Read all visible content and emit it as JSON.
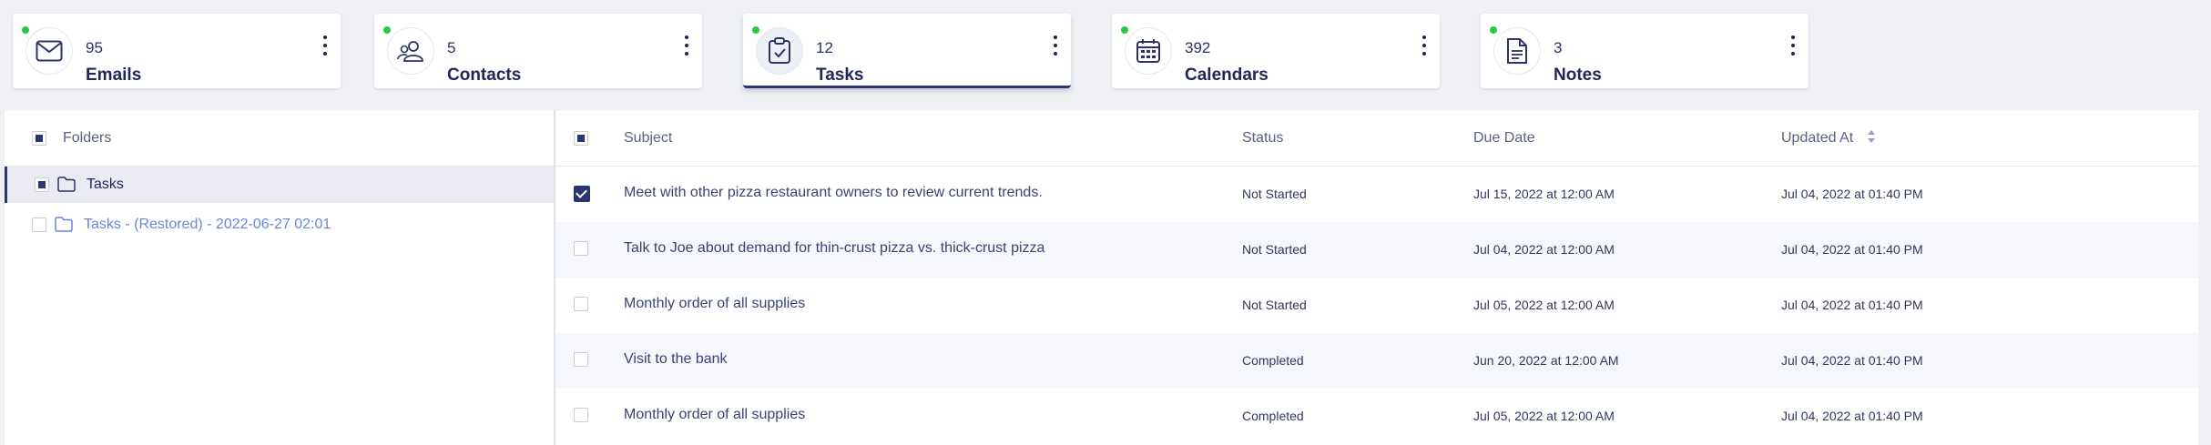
{
  "cards": [
    {
      "count": "95",
      "label": "Emails",
      "icon": "mail-icon",
      "active": false
    },
    {
      "count": "5",
      "label": "Contacts",
      "icon": "contacts-icon",
      "active": false
    },
    {
      "count": "12",
      "label": "Tasks",
      "icon": "clipboard-check-icon",
      "active": true
    },
    {
      "count": "392",
      "label": "Calendars",
      "icon": "calendar-icon",
      "active": false
    },
    {
      "count": "3",
      "label": "Notes",
      "icon": "document-icon",
      "active": false
    }
  ],
  "colors": {
    "accent": "#2b3576",
    "status_dot": "#28c840",
    "restored_link": "#6b86d6",
    "background": "#eff1f4"
  },
  "folders": {
    "header": "Folders",
    "items": [
      {
        "label": "Tasks",
        "selected": true
      },
      {
        "label": "Tasks - (Restored) - 2022-06-27 02:01",
        "selected": false
      }
    ]
  },
  "table": {
    "columns": {
      "subject": "Subject",
      "status": "Status",
      "due_date": "Due Date",
      "updated_at": "Updated At"
    },
    "rows": [
      {
        "subject": "Meet with other pizza restaurant owners to review current trends.",
        "status": "Not Started",
        "due_date": "Jul 15, 2022 at 12:00 AM",
        "updated_at": "Jul 04, 2022 at 01:40 PM",
        "checked": true
      },
      {
        "subject": "Talk to Joe about demand for thin-crust pizza vs. thick-crust pizza",
        "status": "Not Started",
        "due_date": "Jul 04, 2022 at 12:00 AM",
        "updated_at": "Jul 04, 2022 at 01:40 PM",
        "checked": false
      },
      {
        "subject": "Monthly order of all supplies",
        "status": "Not Started",
        "due_date": "Jul 05, 2022 at 12:00 AM",
        "updated_at": "Jul 04, 2022 at 01:40 PM",
        "checked": false
      },
      {
        "subject": "Visit to the bank",
        "status": "Completed",
        "due_date": "Jun 20, 2022 at 12:00 AM",
        "updated_at": "Jul 04, 2022 at 01:40 PM",
        "checked": false
      },
      {
        "subject": "Monthly order of all supplies",
        "status": "Completed",
        "due_date": "Jul 05, 2022 at 12:00 AM",
        "updated_at": "Jul 04, 2022 at 01:40 PM",
        "checked": false
      }
    ]
  }
}
